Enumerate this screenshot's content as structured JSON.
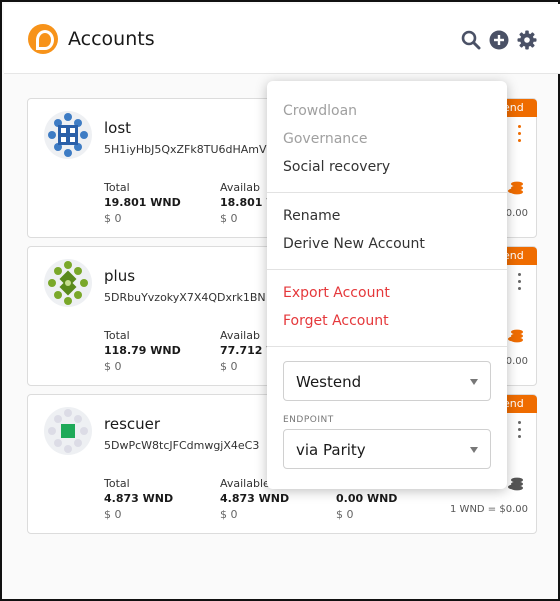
{
  "header": {
    "title": "Accounts"
  },
  "accounts": [
    {
      "name": "lost",
      "address": "5H1iyHbJ5QxZFk8TU6dHAmV",
      "network": "end",
      "total_label": "Total",
      "total": "19.801 WND",
      "total_usd": "$ 0",
      "available_label": "Availab",
      "available": "18.801 WN",
      "available_usd": "$ 0",
      "rate": "$0.00"
    },
    {
      "name": "plus",
      "address": "5DRbuYvzokyX7X4QDxrk1BN",
      "network": "end",
      "total_label": "Total",
      "total": "118.79 WND",
      "total_usd": "$ 0",
      "available_label": "Availab",
      "available": "77.712 W",
      "available_usd": "$ 0",
      "rate": "$0.00"
    },
    {
      "name": "rescuer",
      "address": "5DwPcW8tcJFCdmwgjX4eC3",
      "network": "end",
      "total_label": "Total",
      "total": "4.873 WND",
      "total_usd": "$ 0",
      "available_label": "Available",
      "available": "4.873 WND",
      "available_usd": "$ 0",
      "reserved": "0.00 WND",
      "reserved_usd": "$ 0",
      "rate": "1 WND = $0.00"
    }
  ],
  "menu": {
    "crowdloan": "Crowdloan",
    "governance": "Governance",
    "social_recovery": "Social recovery",
    "rename": "Rename",
    "derive": "Derive New Account",
    "export": "Export Account",
    "forget": "Forget Account",
    "network_select": "Westend",
    "endpoint_label": "ENDPOINT",
    "endpoint_select": "via Parity"
  },
  "colors": {
    "accent": "#ef6c00",
    "danger": "#e5383b",
    "logo": "#f7931a"
  },
  "icons": [
    "polkadot-logo-icon",
    "search-icon",
    "add-circle-icon",
    "gear-icon",
    "kebab-menu-icon",
    "coins-icon",
    "chevron-down-icon"
  ]
}
